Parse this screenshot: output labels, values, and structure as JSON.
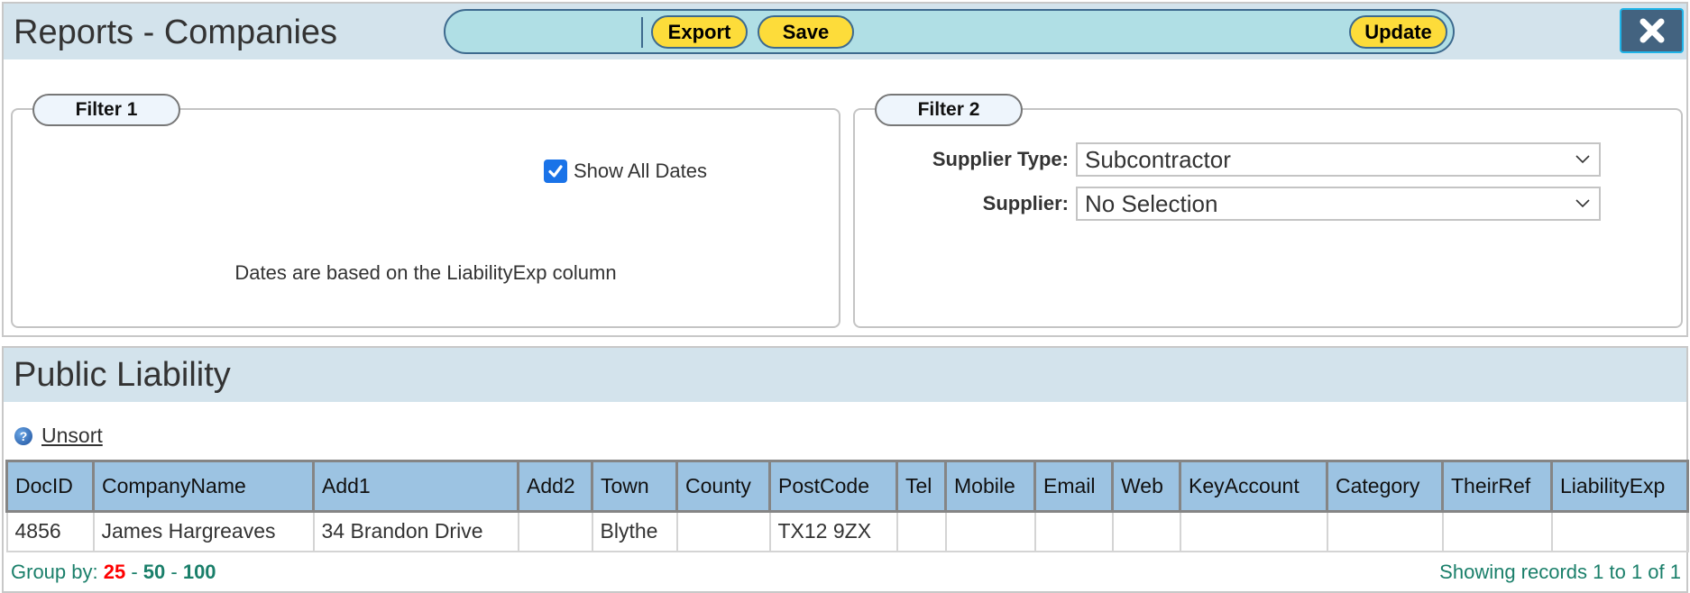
{
  "header": {
    "title": "Reports - Companies",
    "toolbar": {
      "export_label": "Export",
      "save_label": "Save",
      "update_label": "Update"
    },
    "close_icon": "close-x-icon"
  },
  "filter1": {
    "legend": "Filter 1",
    "show_all_dates_label": "Show All Dates",
    "show_all_dates_checked": true,
    "note": "Dates are based on the LiabilityExp column"
  },
  "filter2": {
    "legend": "Filter 2",
    "supplier_type_label": "Supplier Type:",
    "supplier_type_value": "Subcontractor",
    "supplier_label": "Supplier:",
    "supplier_value": "No Selection"
  },
  "report": {
    "title": "Public Liability",
    "help_icon": "question-circle-icon",
    "unsort_label": "Unsort",
    "columns": [
      "DocID",
      "CompanyName",
      "Add1",
      "Add2",
      "Town",
      "County",
      "PostCode",
      "Tel",
      "Mobile",
      "Email",
      "Web",
      "KeyAccount",
      "Category",
      "TheirRef",
      "LiabilityExp"
    ],
    "rows": [
      [
        "4856",
        "James Hargreaves",
        "34 Brandon Drive",
        "",
        "Blythe",
        "",
        "TX12 9ZX",
        "",
        "",
        "",
        "",
        "",
        "",
        "",
        ""
      ]
    ],
    "group_by_label": "Group by:",
    "group_by_options": [
      "25",
      "50",
      "100"
    ],
    "group_by_selected": "25",
    "separator": "-",
    "records_text": "Showing records 1 to 1 of 1"
  },
  "colors": {
    "title_band": "#d3e3ec",
    "toolbar": "#b0dfe5",
    "button": "#fddc3a",
    "close_button": "#436380",
    "table_header": "#9cc3e2",
    "footer_text": "#1a7f6a",
    "active_group": "#ff0000"
  }
}
